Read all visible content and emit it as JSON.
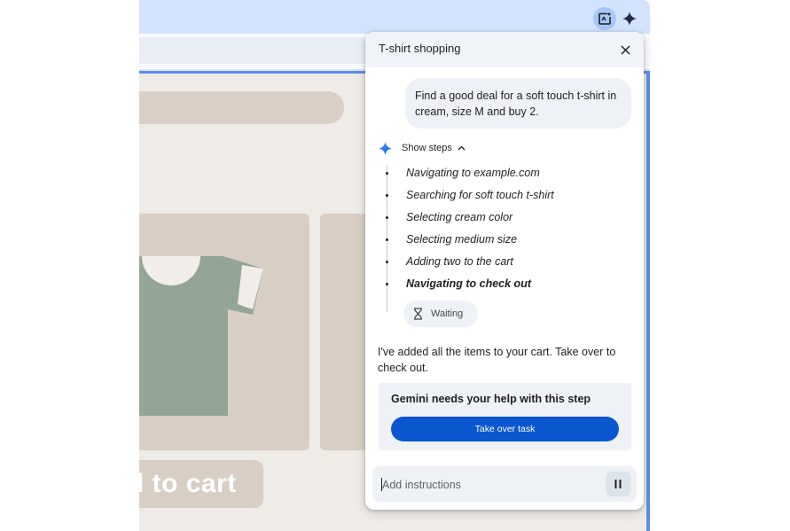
{
  "page": {
    "add_to_cart_label": "d to cart"
  },
  "panel": {
    "title": "T-shirt shopping",
    "user_message": "Find a good deal for a soft touch t-shirt in cream, size M and buy 2.",
    "show_steps_label": "Show steps",
    "steps": [
      "Navigating to example.com",
      "Searching for soft touch t-shirt",
      "Selecting cream color",
      "Selecting medium size",
      "Adding two to the cart",
      "Navigating to check out"
    ],
    "waiting_label": "Waiting",
    "reply": "I've added all the items to your cart. Take over to check out.",
    "help_title": "Gemini needs your help with this step",
    "takeover_label": "Take over task",
    "input_placeholder": "Add instructions"
  },
  "icons": {
    "task": "task-icon",
    "gemini": "gemini-spark-icon",
    "close": "close-icon",
    "chevron": "chevron-up-icon",
    "hourglass": "hourglass-icon",
    "pause": "pause-icon"
  },
  "colors": {
    "accent_blue": "#0b57d0",
    "gemini_blue": "#1a73e8",
    "page_highlight": "#5b8def",
    "page_beige": "#d9cec4",
    "tshirt_green": "#93a596"
  }
}
